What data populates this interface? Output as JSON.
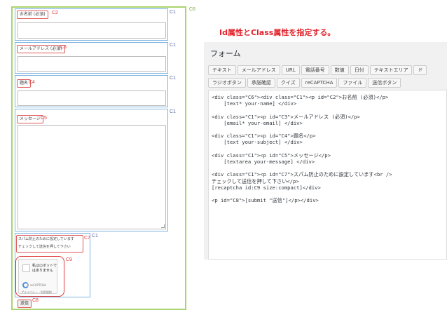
{
  "heading": "Id属性とClass属性を指定する。",
  "form_preview": {
    "container_tag": "C6",
    "fields": [
      {
        "label": "お名前 (必須)",
        "id_tag": "C2",
        "class_tag": "C1"
      },
      {
        "label": "メールアドレス (必須)",
        "id_tag": "C3",
        "class_tag": "C1"
      },
      {
        "label": "題名",
        "id_tag": "C4",
        "class_tag": "C1"
      },
      {
        "label": "メッセージ",
        "id_tag": "C5",
        "class_tag": "C1"
      }
    ],
    "spam": {
      "line1": "スパム防止のために設定しています",
      "line2": "チェックして送信を押して下さい",
      "id_tag": "C7",
      "class_tag": "C1"
    },
    "recaptcha": {
      "zone_tag": "C9",
      "line1": "私はロボットで",
      "line2": "はありません",
      "brand": "reCAPTCHA",
      "privacy": "プライバシー・利用規約"
    },
    "submit": {
      "label": "送信",
      "id_tag": "C8"
    }
  },
  "editor": {
    "title": "フォーム",
    "tag_buttons_row1": [
      "テキスト",
      "メールアドレス",
      "URL",
      "電話番号",
      "数値",
      "日付",
      "テキストエリア",
      "ド"
    ],
    "tag_buttons_row2": [
      "ラジオボタン",
      "承諾確認",
      "クイズ",
      "reCAPTCHA",
      "ファイル",
      "送信ボタン"
    ],
    "code_lines": [
      "<div class=\"C6\"><div class=\"C1\"><p id=\"C2\">お名前 (必須)</p>",
      "    [text* your-name] </div>",
      "",
      "<div class=\"C1\"><p id=\"C3\">メールアドレス (必須)</p>",
      "    [email* your-email] </div>",
      "",
      "<div class=\"C1\"><p id=\"C4\">題名</p>",
      "    [text your-subject] </div>",
      "",
      "<div class=\"C1\"><p id=\"C5\">メッセージ</p>",
      "    [textarea your-message] </div>",
      "",
      "<div class=\"C1\"><p id=\"C7\">スパム防止のために設定しています<br />",
      "チェックして送信を押して下さい</p>",
      "[recaptcha id:C9 size:compact]</div>",
      "",
      "<p id=\"C8\">[submit \"送信\"]</p></div>"
    ]
  },
  "colors": {
    "container_border": "#a9d46f",
    "class_border": "#7eb3e0",
    "id_highlight": "#e03a3a",
    "heading": "#e3232c"
  }
}
